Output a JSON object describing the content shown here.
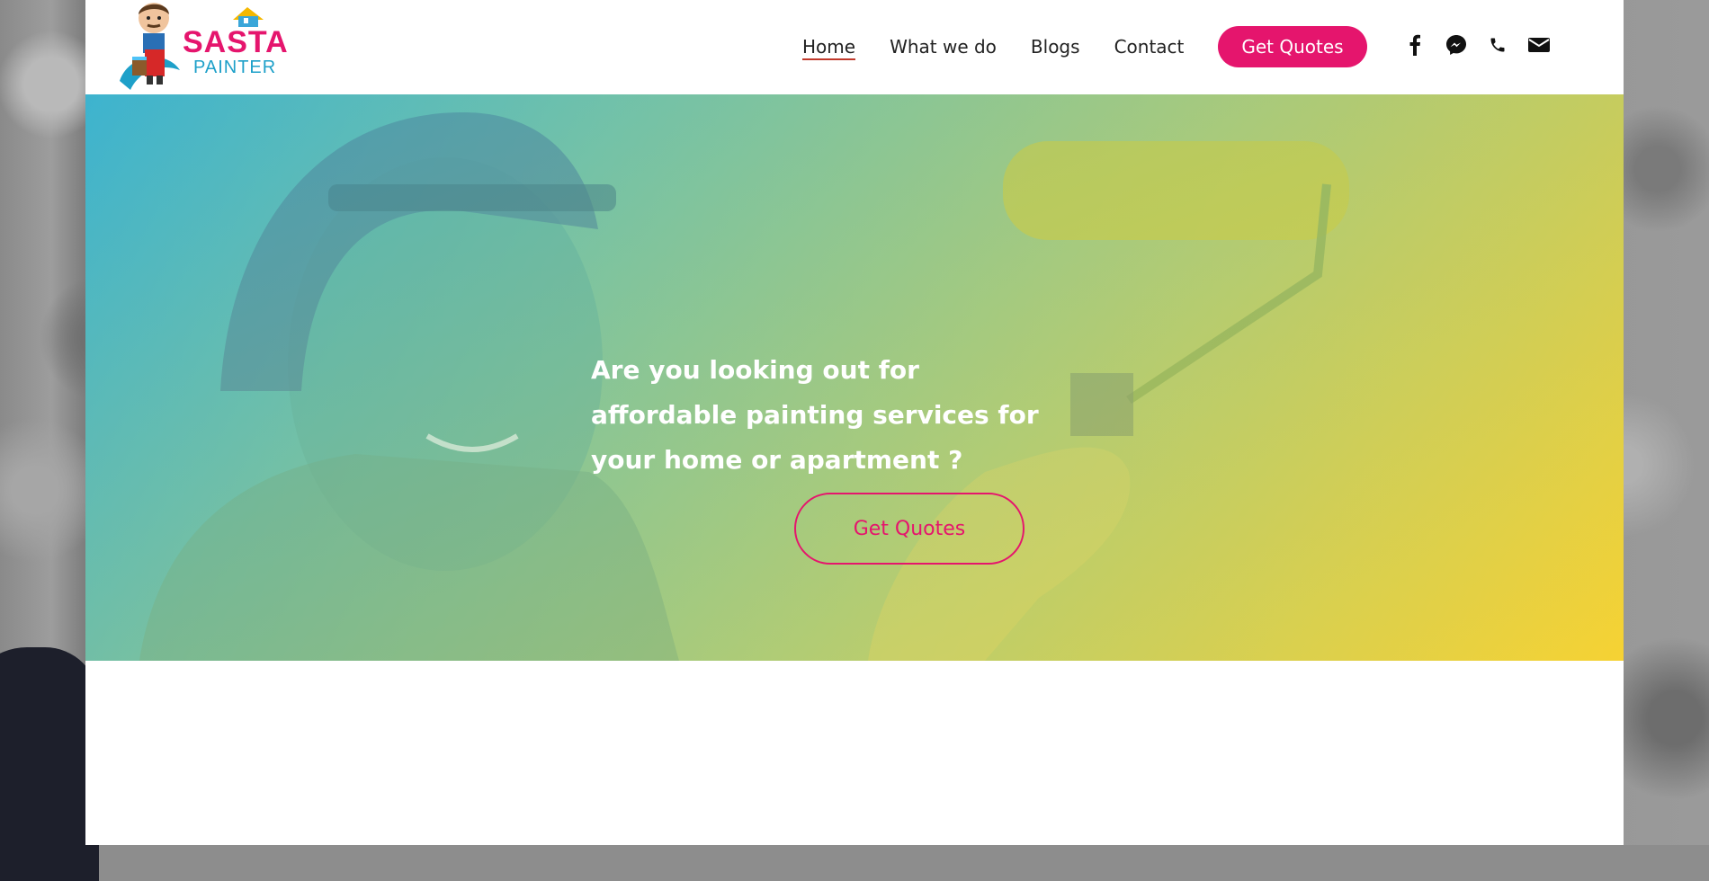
{
  "brand": {
    "name_line1": "SASTA",
    "name_line2": "PAINTER"
  },
  "nav": {
    "items": [
      {
        "label": "Home",
        "active": true
      },
      {
        "label": "What we do"
      },
      {
        "label": "Blogs"
      },
      {
        "label": "Contact"
      }
    ],
    "cta_label": "Get Quotes"
  },
  "social": {
    "icons": [
      "facebook-icon",
      "messenger-icon",
      "phone-icon",
      "email-icon"
    ]
  },
  "hero": {
    "headline": "Are you looking out for affordable painting services for your home or apartment ?",
    "button_label": "Get Quotes"
  },
  "colors": {
    "accent": "#e5156d",
    "hero_gradient_start": "#3db3cf",
    "hero_gradient_end": "#f6d233"
  }
}
